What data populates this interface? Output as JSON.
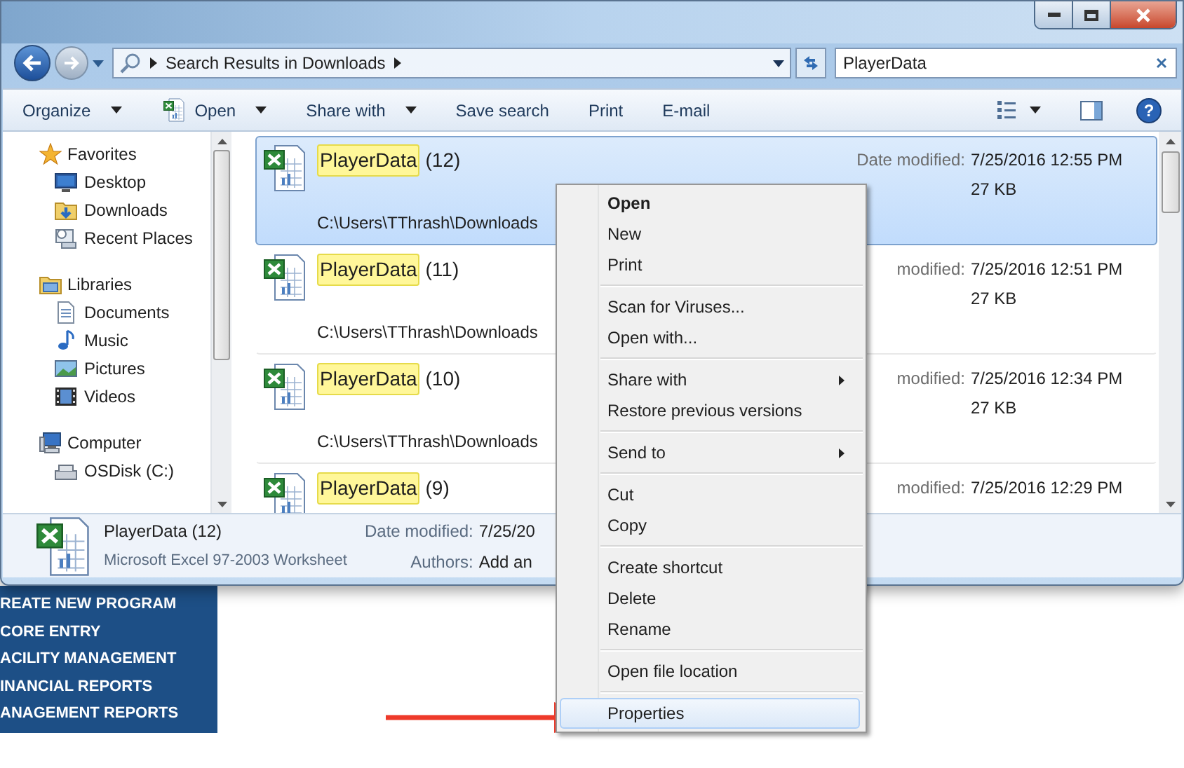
{
  "address": {
    "location": "Search Results in Downloads"
  },
  "search": {
    "value": "PlayerData"
  },
  "toolbar": [
    {
      "label": "Organize",
      "kind": "menu"
    },
    {
      "label": "Open",
      "kind": "excel"
    },
    {
      "label": "Share with",
      "kind": "menu"
    },
    {
      "label": "Save search",
      "kind": "plain"
    },
    {
      "label": "Print",
      "kind": "plain"
    },
    {
      "label": "E-mail",
      "kind": "plain"
    }
  ],
  "help": {
    "label": "?"
  },
  "sidebar": [
    {
      "label": "Favorites",
      "kind": "star",
      "children": [
        {
          "label": "Desktop",
          "kind": "desktop"
        },
        {
          "label": "Downloads",
          "kind": "downloads"
        },
        {
          "label": "Recent Places",
          "kind": "recent"
        }
      ]
    },
    {
      "label": "Libraries",
      "kind": "library",
      "children": [
        {
          "label": "Documents",
          "kind": "document"
        },
        {
          "label": "Music",
          "kind": "music"
        },
        {
          "label": "Pictures",
          "kind": "picture"
        },
        {
          "label": "Videos",
          "kind": "video"
        }
      ]
    },
    {
      "label": "Computer",
      "kind": "computer",
      "children": [
        {
          "label": "OSDisk (C:)",
          "kind": "disk"
        }
      ]
    }
  ],
  "results": [
    {
      "match": "PlayerData",
      "suffix": "(12)",
      "path": "C:\\Users\\TThrash\\Downloads",
      "date_label": "Date modified:",
      "date": "7/25/2016 12:55 PM",
      "size": "27 KB",
      "selected": true
    },
    {
      "match": "PlayerData",
      "suffix": "(11)",
      "path": "C:\\Users\\TThrash\\Downloads",
      "date_label": "modified:",
      "date": "7/25/2016 12:51 PM",
      "size": "27 KB",
      "selected": false
    },
    {
      "match": "PlayerData",
      "suffix": "(10)",
      "path": "C:\\Users\\TThrash\\Downloads",
      "date_label": "modified:",
      "date": "7/25/2016 12:34 PM",
      "size": "27 KB",
      "selected": false
    },
    {
      "match": "PlayerData",
      "suffix": "(9)",
      "date_label": "modified:",
      "date": "7/25/2016 12:29 PM",
      "selected": false
    }
  ],
  "details": {
    "name": "PlayerData (12)",
    "type": "Microsoft Excel 97-2003 Worksheet",
    "date_label": "Date modified:",
    "date": "7/25/20",
    "authors_label": "Authors:",
    "authors": "Add an"
  },
  "context_menu": [
    [
      {
        "label": "Open",
        "default": true,
        "submenu": false,
        "selected": false
      },
      {
        "label": "New",
        "default": false,
        "submenu": false,
        "selected": false
      },
      {
        "label": "Print",
        "default": false,
        "submenu": false,
        "selected": false
      }
    ],
    [
      {
        "label": "Scan for Viruses...",
        "default": false,
        "submenu": false,
        "selected": false
      },
      {
        "label": "Open with...",
        "default": false,
        "submenu": false,
        "selected": false
      }
    ],
    [
      {
        "label": "Share with",
        "default": false,
        "submenu": true,
        "selected": false
      },
      {
        "label": "Restore previous versions",
        "default": false,
        "submenu": false,
        "selected": false
      }
    ],
    [
      {
        "label": "Send to",
        "default": false,
        "submenu": true,
        "selected": false
      }
    ],
    [
      {
        "label": "Cut",
        "default": false,
        "submenu": false,
        "selected": false
      },
      {
        "label": "Copy",
        "default": false,
        "submenu": false,
        "selected": false
      }
    ],
    [
      {
        "label": "Create shortcut",
        "default": false,
        "submenu": false,
        "selected": false
      },
      {
        "label": "Delete",
        "default": false,
        "submenu": false,
        "selected": false
      },
      {
        "label": "Rename",
        "default": false,
        "submenu": false,
        "selected": false
      }
    ],
    [
      {
        "label": "Open file location",
        "default": false,
        "submenu": false,
        "selected": false
      }
    ],
    [
      {
        "label": "Properties",
        "default": false,
        "submenu": false,
        "selected": true
      }
    ]
  ],
  "website_menu": [
    "REATE NEW PROGRAM",
    "CORE ENTRY",
    "ACILITY MANAGEMENT",
    "INANCIAL REPORTS",
    "ANAGEMENT REPORTS"
  ]
}
